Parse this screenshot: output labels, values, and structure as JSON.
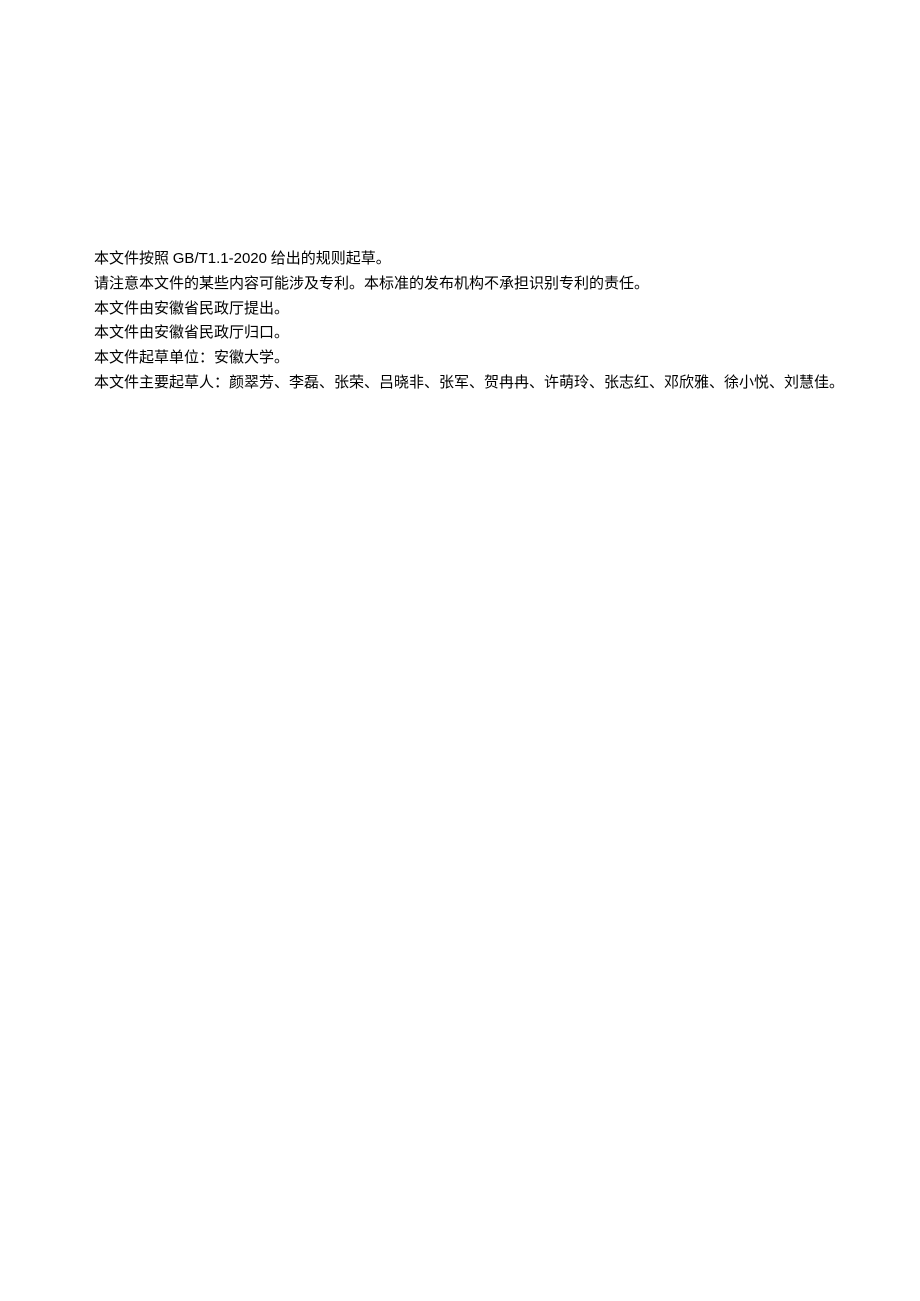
{
  "paragraphs": {
    "p1_prefix": "本文件按照 ",
    "p1_latin": "GB/T1.1-2020",
    "p1_suffix": " 给出的规则起草。",
    "p2": "请注意本文件的某些内容可能涉及专利。本标准的发布机构不承担识别专利的责任。",
    "p3": "本文件由安徽省民政厅提出。",
    "p4": "本文件由安徽省民政厅归口。",
    "p5": "本文件起草单位：安徽大学。",
    "p6": "本文件主要起草人：颜翠芳、李磊、张荣、吕晓非、张军、贺冉冉、许萌玲、张志红、邓欣雅、徐小悦、刘慧佳。"
  }
}
